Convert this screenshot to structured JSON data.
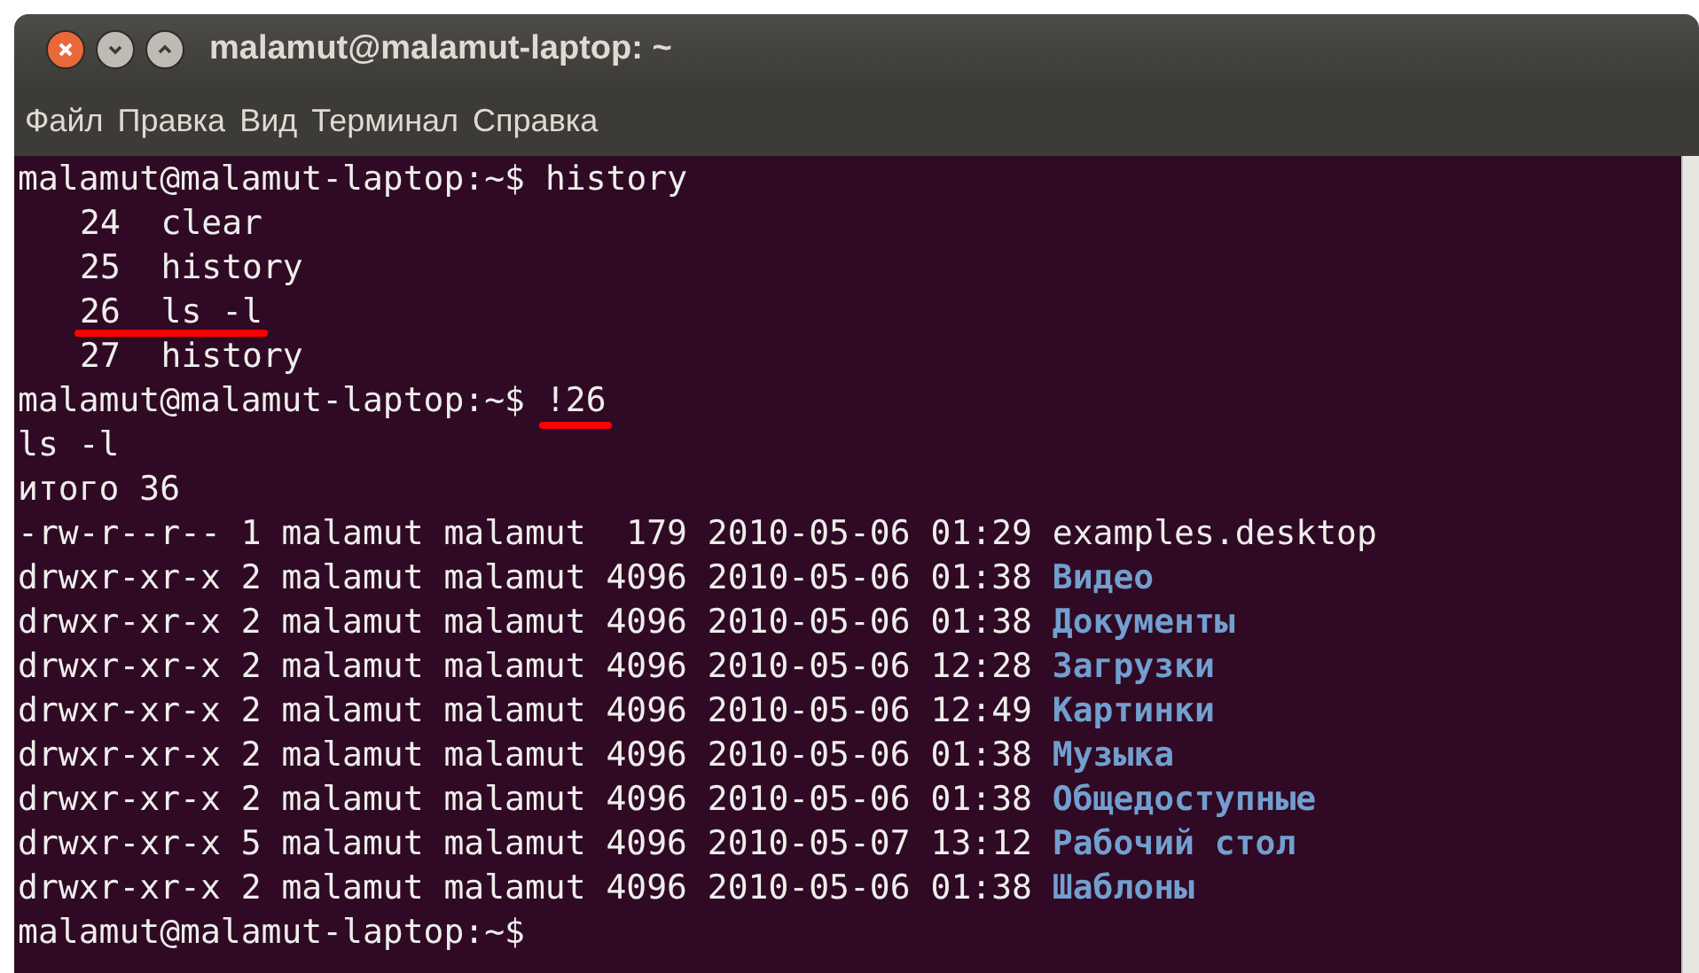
{
  "window": {
    "title": "malamut@malamut-laptop: ~"
  },
  "menu": [
    "Файл",
    "Правка",
    "Вид",
    "Терминал",
    "Справка"
  ],
  "lines": [
    {
      "kind": "prompt",
      "prompt": "malamut@malamut-laptop:~$",
      "command": "history",
      "underlined": false
    },
    {
      "kind": "history",
      "number": "24",
      "command": "clear",
      "underlined": false
    },
    {
      "kind": "history",
      "number": "25",
      "command": "history",
      "underlined": false
    },
    {
      "kind": "history",
      "number": "26",
      "command": "ls -l",
      "underlined": true
    },
    {
      "kind": "history",
      "number": "27",
      "command": "history",
      "underlined": false
    },
    {
      "kind": "prompt",
      "prompt": "malamut@malamut-laptop:~$",
      "command": "!26",
      "underlined": true
    },
    {
      "kind": "output",
      "text": "ls -l"
    },
    {
      "kind": "output",
      "text": "итого 36"
    },
    {
      "kind": "file",
      "info": "-rw-r--r-- 1 malamut malamut  179 2010-05-06 01:29",
      "name": "examples.desktop"
    },
    {
      "kind": "dir",
      "info": "drwxr-xr-x 2 malamut malamut 4096 2010-05-06 01:38",
      "name": "Видео"
    },
    {
      "kind": "dir",
      "info": "drwxr-xr-x 2 malamut malamut 4096 2010-05-06 01:38",
      "name": "Документы"
    },
    {
      "kind": "dir",
      "info": "drwxr-xr-x 2 malamut malamut 4096 2010-05-06 12:28",
      "name": "Загрузки"
    },
    {
      "kind": "dir",
      "info": "drwxr-xr-x 2 malamut malamut 4096 2010-05-06 12:49",
      "name": "Картинки"
    },
    {
      "kind": "dir",
      "info": "drwxr-xr-x 2 malamut malamut 4096 2010-05-06 01:38",
      "name": "Музыка"
    },
    {
      "kind": "dir",
      "info": "drwxr-xr-x 2 malamut malamut 4096 2010-05-06 01:38",
      "name": "Общедоступные"
    },
    {
      "kind": "dir",
      "info": "drwxr-xr-x 5 malamut malamut 4096 2010-05-07 13:12",
      "name": "Рабочий стол"
    },
    {
      "kind": "dir",
      "info": "drwxr-xr-x 2 malamut malamut 4096 2010-05-06 01:38",
      "name": "Шаблоны"
    },
    {
      "kind": "prompt",
      "prompt": "malamut@malamut-laptop:~$",
      "underlined": false
    }
  ]
}
